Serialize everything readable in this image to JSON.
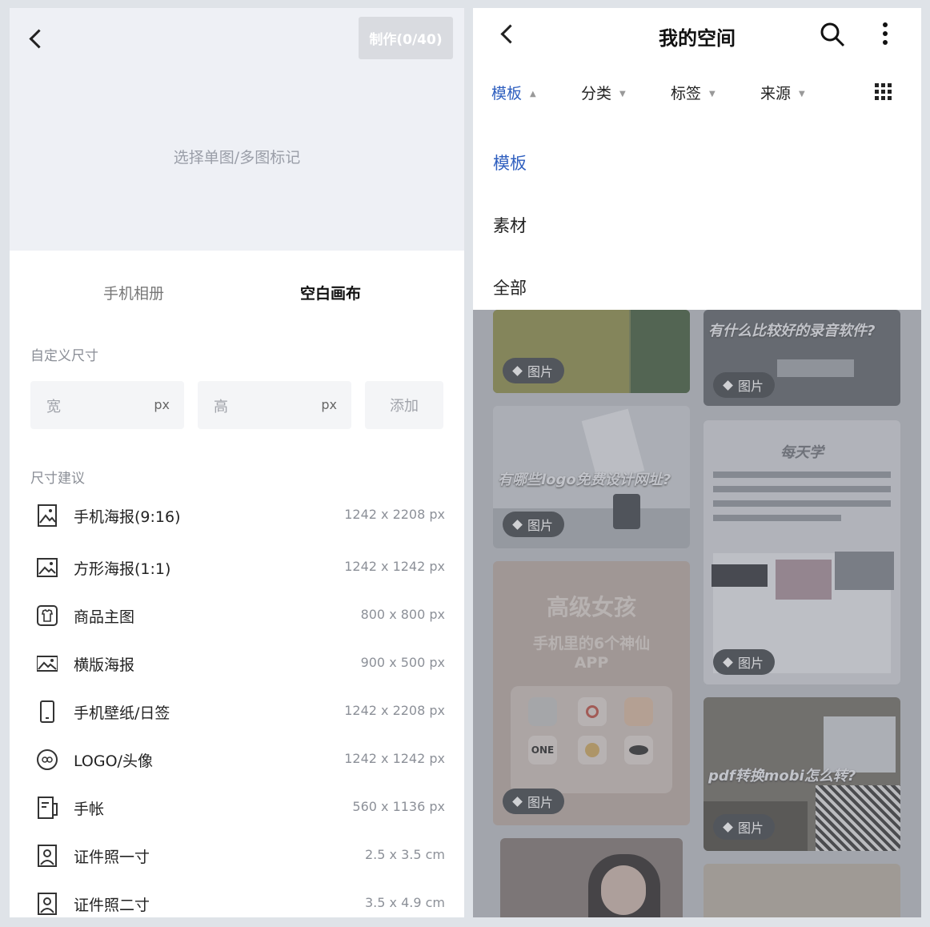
{
  "left": {
    "make_label": "制作(0/40)",
    "hint": "选择单图/多图标记",
    "tabs": {
      "phone": "手机相册",
      "canvas": "空白画布"
    },
    "custom_title": "自定义尺寸",
    "width_placeholder": "宽",
    "height_placeholder": "高",
    "unit": "px",
    "add_label": "添加",
    "suggest_title": "尺寸建议",
    "sizes": [
      {
        "name": "手机海报(9:16)",
        "dims": "1242 x 2208 px",
        "icon": "portrait-image-icon"
      },
      {
        "name": "方形海报(1:1)",
        "dims": "1242 x 1242 px",
        "icon": "square-image-icon"
      },
      {
        "name": "商品主图",
        "dims": "800 x 800 px",
        "icon": "shirt-icon"
      },
      {
        "name": "横版海报",
        "dims": "900 x 500 px",
        "icon": "landscape-image-icon"
      },
      {
        "name": "手机壁纸/日签",
        "dims": "1242 x 2208 px",
        "icon": "phone-icon"
      },
      {
        "name": "LOGO/头像",
        "dims": "1242 x 1242 px",
        "icon": "logo-circle-icon"
      },
      {
        "name": "手帐",
        "dims": "560 x 1136 px",
        "icon": "notebook-icon"
      },
      {
        "name": "证件照一寸",
        "dims": "2.5 x 3.5 cm",
        "icon": "id-photo-icon"
      },
      {
        "name": "证件照二寸",
        "dims": "3.5 x 4.9 cm",
        "icon": "id-photo-icon"
      }
    ]
  },
  "right": {
    "title": "我的空间",
    "filters": [
      {
        "label": "模板",
        "active": true
      },
      {
        "label": "分类",
        "active": false
      },
      {
        "label": "标签",
        "active": false
      },
      {
        "label": "来源",
        "active": false
      }
    ],
    "dropdown": [
      "模板",
      "素材",
      "全部"
    ],
    "dropdown_selected": "模板",
    "chip_label": "图片",
    "cards": {
      "c2": "有什么比较好的录音软件?",
      "c3": "有哪些logo免费设计网址?",
      "c4": "每天学",
      "c5a": "高级女孩",
      "c5b": "手机里的6个神仙",
      "c5c": "APP",
      "c6": "pdf转换mobi怎么转?",
      "one_logo": "ONE"
    }
  },
  "colors": {
    "accent": "#2f5fbf"
  }
}
